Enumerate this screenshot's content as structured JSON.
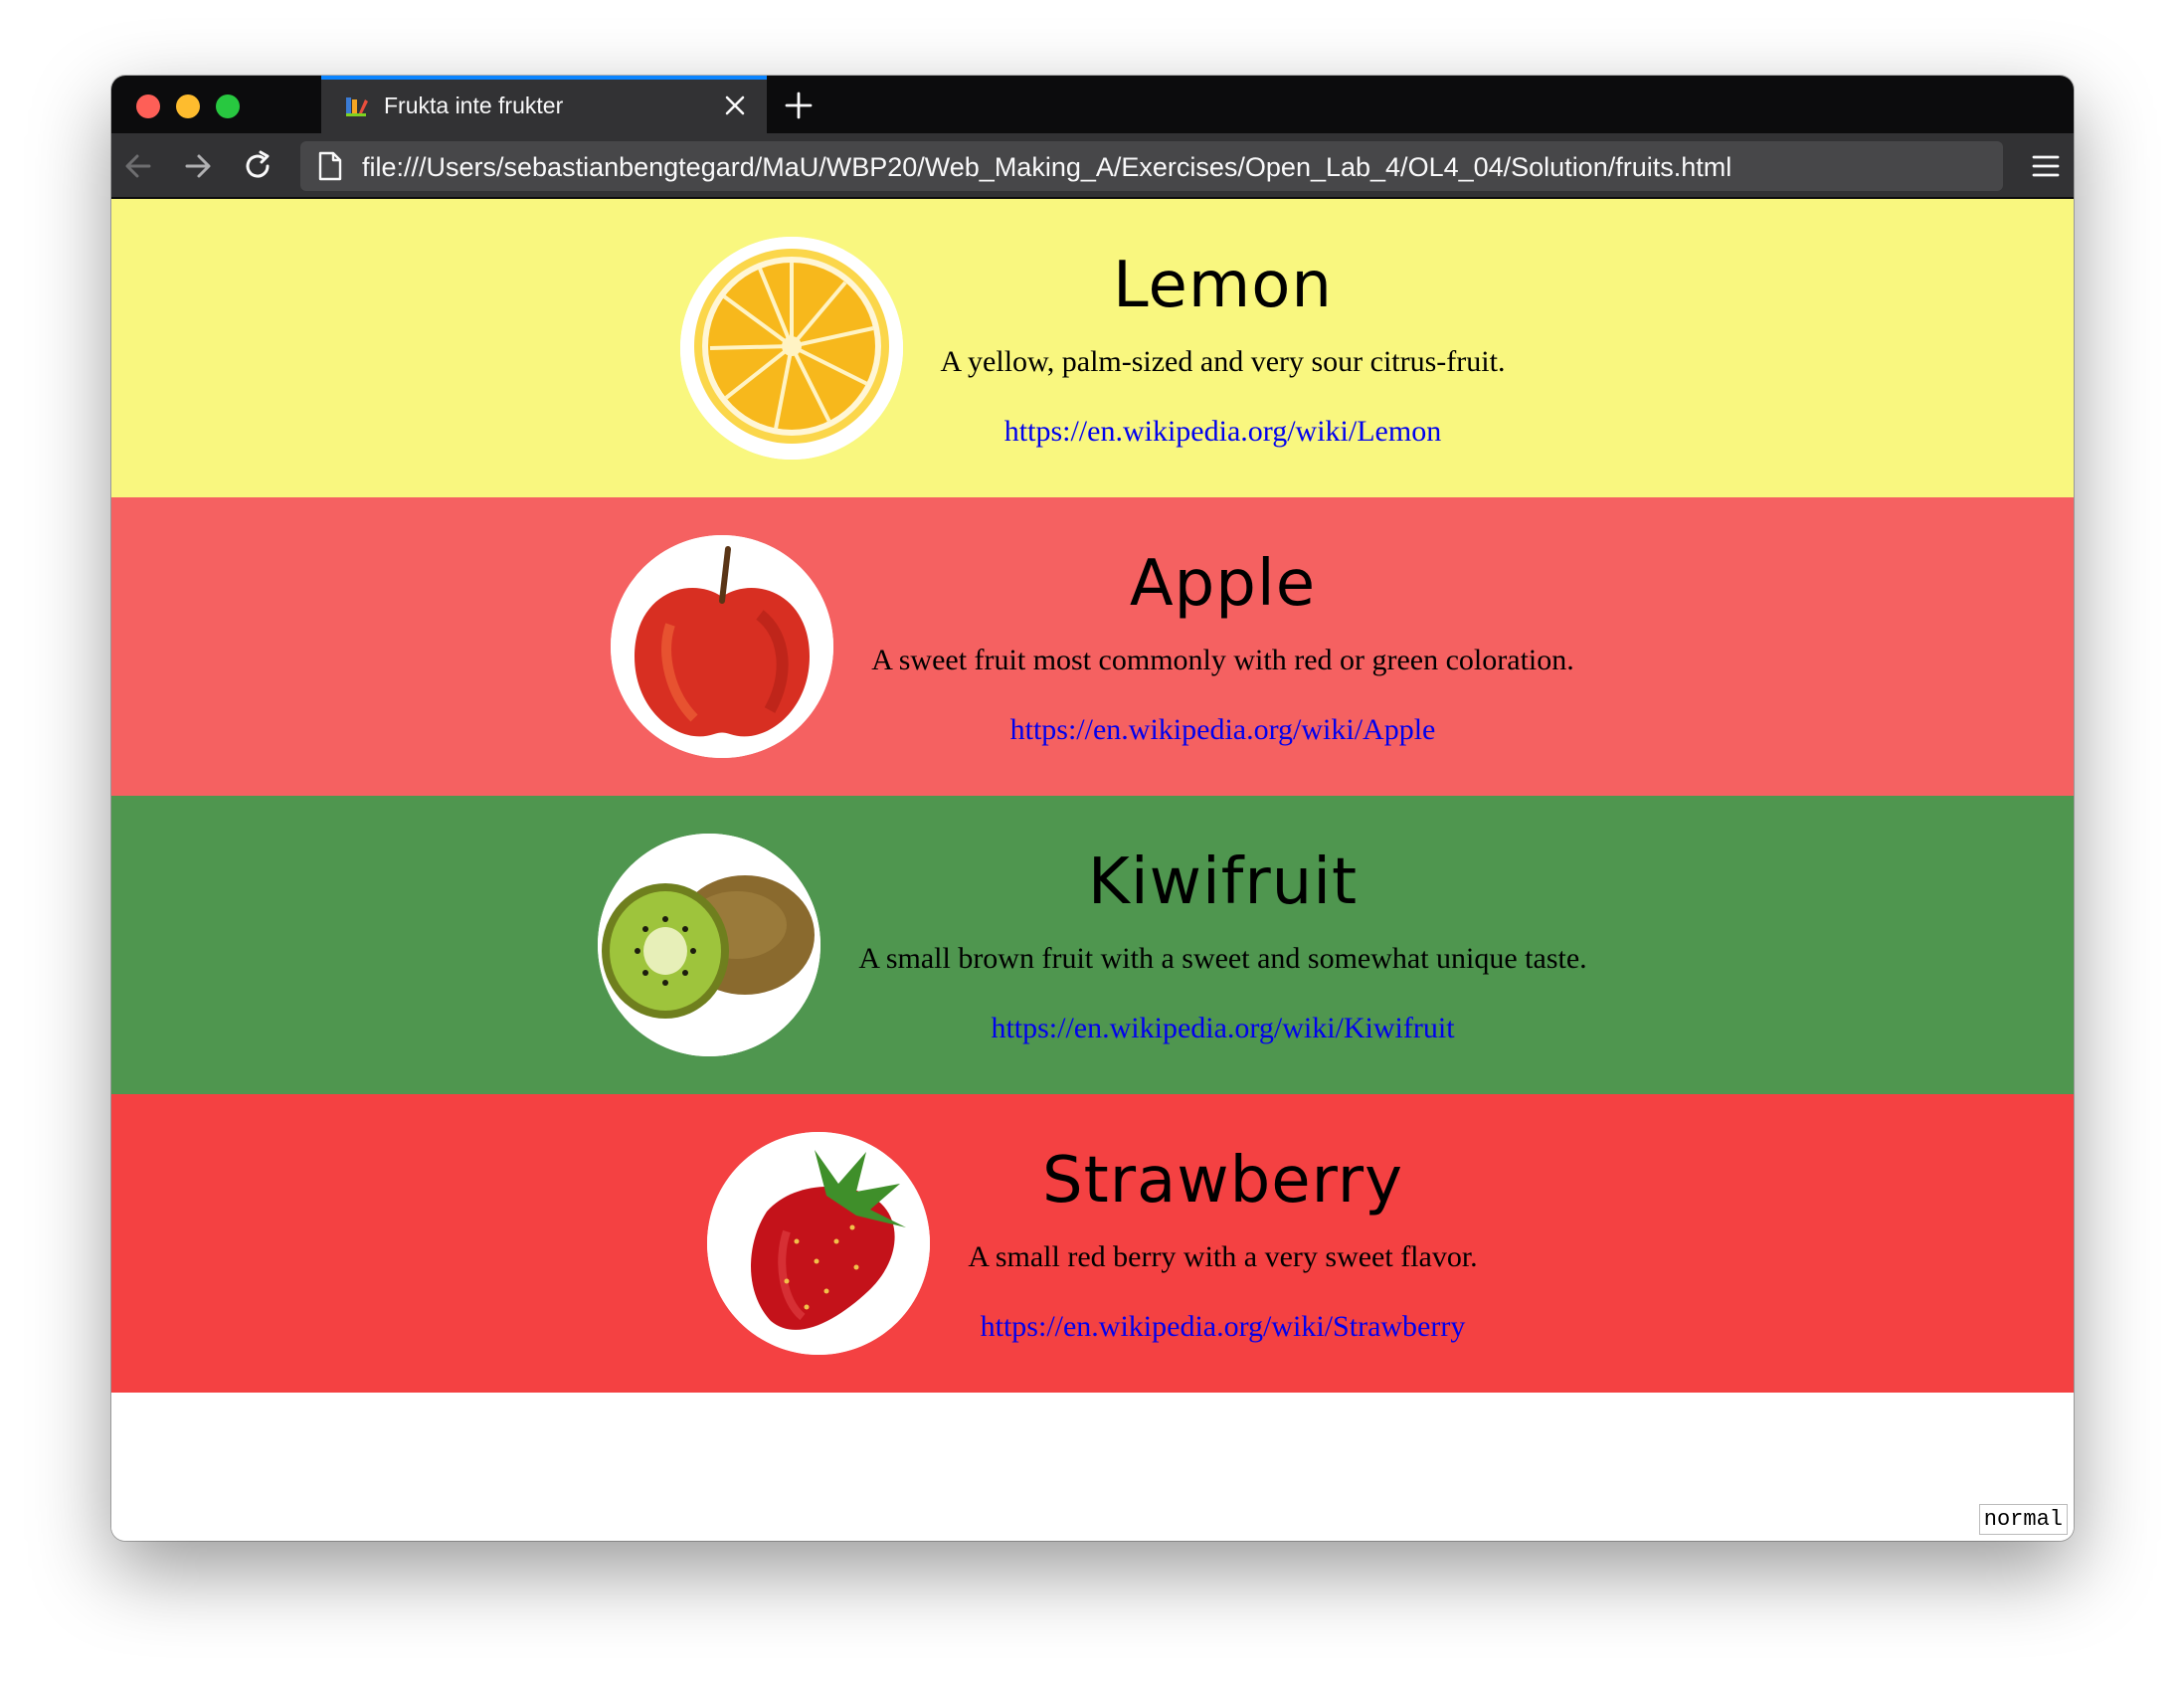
{
  "browser": {
    "tab_title": "Frukta inte frukter",
    "url": "file:///Users/sebastianbengtegard/MaU/WBP20/Web_Making_A/Exercises/Open_Lab_4/OL4_04/Solution/fruits.html"
  },
  "fruits": [
    {
      "name": "Lemon",
      "description": "A yellow, palm-sized and very sour citrus-fruit.",
      "link": "https://en.wikipedia.org/wiki/Lemon",
      "background": "#f9f77f"
    },
    {
      "name": "Apple",
      "description": "A sweet fruit most commonly with red or green coloration.",
      "link": "https://en.wikipedia.org/wiki/Apple",
      "background": "#f56161"
    },
    {
      "name": "Kiwifruit",
      "description": "A small brown fruit with a sweet and somewhat unique taste.",
      "link": "https://en.wikipedia.org/wiki/Kiwifruit",
      "background": "#4f964f"
    },
    {
      "name": "Strawberry",
      "description": "A small red berry with a very sweet flavor.",
      "link": "https://en.wikipedia.org/wiki/Strawberry",
      "background": "#f44142"
    }
  ],
  "mode_badge": "normal"
}
